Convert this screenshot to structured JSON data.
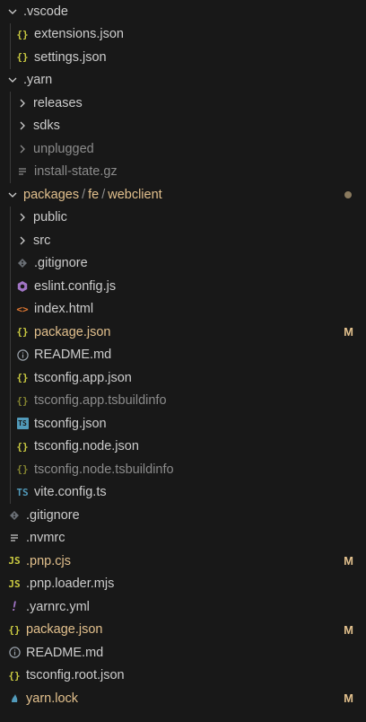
{
  "explorer": {
    "rows": [
      {
        "label": "name:.vscode",
        "type": "folder"
      },
      {
        "label": "extensions.json"
      },
      {
        "label": "settings.json"
      },
      {
        "label": ".yarn"
      },
      {
        "label": "releases"
      },
      {
        "label": "sdks"
      },
      {
        "label": "unplugged"
      },
      {
        "label": "install-state.gz"
      },
      {
        "segments": [
          "packages",
          "fe",
          "webclient"
        ]
      },
      {
        "label": "public"
      },
      {
        "label": "src"
      },
      {
        "label": ".gitignore"
      },
      {
        "label": "eslint.config.js"
      },
      {
        "label": "index.html"
      },
      {
        "label": "package.json",
        "badge": "M"
      },
      {
        "label": "README.md"
      },
      {
        "label": "tsconfig.app.json"
      },
      {
        "label": "tsconfig.app.tsbuildinfo"
      },
      {
        "label": "tsconfig.json"
      },
      {
        "label": "tsconfig.node.json"
      },
      {
        "label": "tsconfig.node.tsbuildinfo"
      },
      {
        "label": "vite.config.ts"
      },
      {
        "label": ".gitignore"
      },
      {
        "label": ".nvmrc"
      },
      {
        "label": ".pnp.cjs",
        "badge": "M"
      },
      {
        "label": ".pnp.loader.mjs"
      },
      {
        "label": ".yarnrc.yml"
      },
      {
        "label": "package.json",
        "badge": "M"
      },
      {
        "label": "README.md"
      },
      {
        "label": "tsconfig.root.json"
      },
      {
        "label": "yarn.lock",
        "badge": "M"
      }
    ]
  },
  "icons": {
    "json": "{}",
    "js": "JS",
    "html": "<>",
    "ts": "TS",
    "yml": "!",
    "info": "i",
    "git": "◆"
  },
  "colors": {
    "background": "#181818",
    "text": "#cccccc",
    "dim_text": "#8b8b8b",
    "modified": "#e2c08d",
    "json_icon": "#cbcb41",
    "ts_icon": "#519aba",
    "html_icon": "#e37933",
    "eslint_icon": "#a074c4"
  }
}
